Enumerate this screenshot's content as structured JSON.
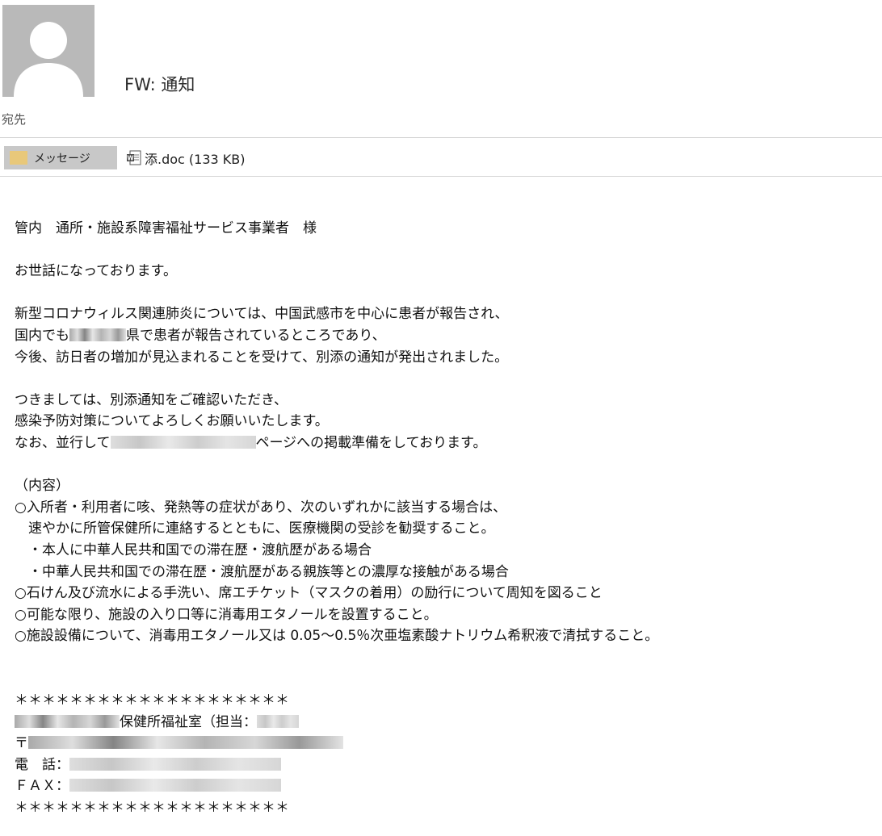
{
  "email": {
    "subject": "FW: 通知",
    "to_label": "宛先"
  },
  "attachments": {
    "message_tab": "メッセージ",
    "file_name": "添.doc (133 KB)"
  },
  "body": {
    "addressee": "管内　通所・施設系障害福祉サービス事業者　様",
    "greeting": "お世話になっております。",
    "p1_l1": "新型コロナウィルス関連肺炎については、中国武感市を中心に患者が報告され、",
    "p1_l2_a": "国内でも",
    "p1_l2_b": "県で患者が報告されているところであり、",
    "p1_l3": "今後、訪日者の増加が見込まれることを受けて、別添の通知が発出されました。",
    "p2_l1": "つきましては、別添通知をご確認いただき、",
    "p2_l2": "感染予防対策についてよろしくお願いいたします。",
    "p2_l3_a": "なお、並行して",
    "p2_l3_b": "ページへの掲載準備をしております。",
    "content_header": "（内容）",
    "item1_l1": "○入所者・利用者に咳、発熱等の症状があり、次のいずれかに該当する場合は、",
    "item1_l2": "　速やかに所管保健所に連絡するとともに、医療機関の受診を勧奨すること。",
    "item1_sub1": "　・本人に中華人民共和国での滞在歴・渡航歴がある場合",
    "item1_sub2": "　・中華人民共和国での滞在歴・渡航歴がある親族等との濃厚な接触がある場合",
    "item2": "○石けん及び流水による手洗い、席エチケット（マスクの着用）の励行について周知を図ること",
    "item3": "○可能な限り、施設の入り口等に消毒用エタノールを設置すること。",
    "item4": "○施設設備について、消毒用エタノール又は 0.05～0.5％次亜塩素酸ナトリウム希釈液で清拭すること。"
  },
  "signature": {
    "stars_top": "＊＊＊＊＊＊＊＊＊＊＊＊＊＊＊＊＊＊＊＊",
    "office": "保健所福祉室（担当：",
    "postal": "〒",
    "tel_label": "電　話：",
    "fax_label": "ＦＡＸ：",
    "stars_bottom": "＊＊＊＊＊＊＊＊＊＊＊＊＊＊＊＊＊＊＊＊"
  },
  "icons": {
    "avatar": "person-placeholder-icon",
    "folder": "folder-icon",
    "attachment": "word-document-icon"
  },
  "colors": {
    "avatar_bg": "#b9b9b9",
    "tab_bg": "#c8c8c8",
    "folder": "#e8c87a"
  }
}
